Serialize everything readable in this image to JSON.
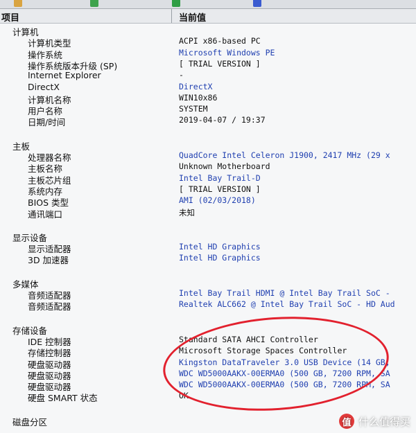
{
  "header": {
    "col_item": "项目",
    "col_value": "当前值"
  },
  "sections": [
    {
      "title": "计算机",
      "fields": [
        {
          "label": "计算机类型",
          "value": "ACPI x86-based PC",
          "link": false
        },
        {
          "label": "操作系统",
          "value": "Microsoft Windows PE",
          "link": true
        },
        {
          "label": "操作系统版本升级 (SP)",
          "value": "[ TRIAL VERSION ]",
          "link": false
        },
        {
          "label": "Internet Explorer",
          "value": "-",
          "link": false
        },
        {
          "label": "DirectX",
          "value": "DirectX",
          "link": true
        },
        {
          "label": "计算机名称",
          "value": "WIN10x86",
          "link": false
        },
        {
          "label": "用户名称",
          "value": "SYSTEM",
          "link": false
        },
        {
          "label": "日期/时间",
          "value": "2019-04-07 / 19:37",
          "link": false
        }
      ]
    },
    {
      "title": "主板",
      "fields": [
        {
          "label": "处理器名称",
          "value": "QuadCore Intel Celeron J1900, 2417 MHz (29 x",
          "link": true
        },
        {
          "label": "主板名称",
          "value": "Unknown Motherboard",
          "link": false
        },
        {
          "label": "主板芯片组",
          "value": "Intel Bay Trail-D",
          "link": true
        },
        {
          "label": "系统内存",
          "value": "[ TRIAL VERSION ]",
          "link": false
        },
        {
          "label": "BIOS 类型",
          "value": "AMI (02/03/2018)",
          "link": true
        },
        {
          "label": "通讯端口",
          "value": "未知",
          "link": false
        }
      ]
    },
    {
      "title": "显示设备",
      "fields": [
        {
          "label": "显示适配器",
          "value": "Intel HD Graphics",
          "link": true
        },
        {
          "label": "3D 加速器",
          "value": "Intel HD Graphics",
          "link": true
        }
      ]
    },
    {
      "title": "多媒体",
      "fields": [
        {
          "label": "音频适配器",
          "value": "Intel Bay Trail HDMI @ Intel Bay Trail SoC -",
          "link": true
        },
        {
          "label": "音频适配器",
          "value": "Realtek ALC662 @ Intel Bay Trail SoC - HD Aud",
          "link": true
        }
      ]
    },
    {
      "title": "存储设备",
      "fields": [
        {
          "label": "IDE 控制器",
          "value": "Standard SATA AHCI Controller",
          "link": false
        },
        {
          "label": "存储控制器",
          "value": "Microsoft Storage Spaces Controller",
          "link": false
        },
        {
          "label": "硬盘驱动器",
          "value": "Kingston DataTraveler 3.0 USB Device  (14 GB,",
          "link": true
        },
        {
          "label": "硬盘驱动器",
          "value": "WDC WD5000AAKX-00ERMA0   (500 GB, 7200 RPM, SA",
          "link": true
        },
        {
          "label": "硬盘驱动器",
          "value": "WDC WD5000AAKX-00ERMA0   (500 GB, 7200 RPM, SA",
          "link": true
        },
        {
          "label": "硬盘 SMART 状态",
          "value": "OK",
          "link": false
        }
      ]
    },
    {
      "title": "磁盘分区",
      "fields": []
    }
  ],
  "watermark": {
    "badge": "值",
    "text": "什么值得买"
  },
  "colors": {
    "link": "#1f3fb0",
    "annotation": "#e2212e"
  }
}
